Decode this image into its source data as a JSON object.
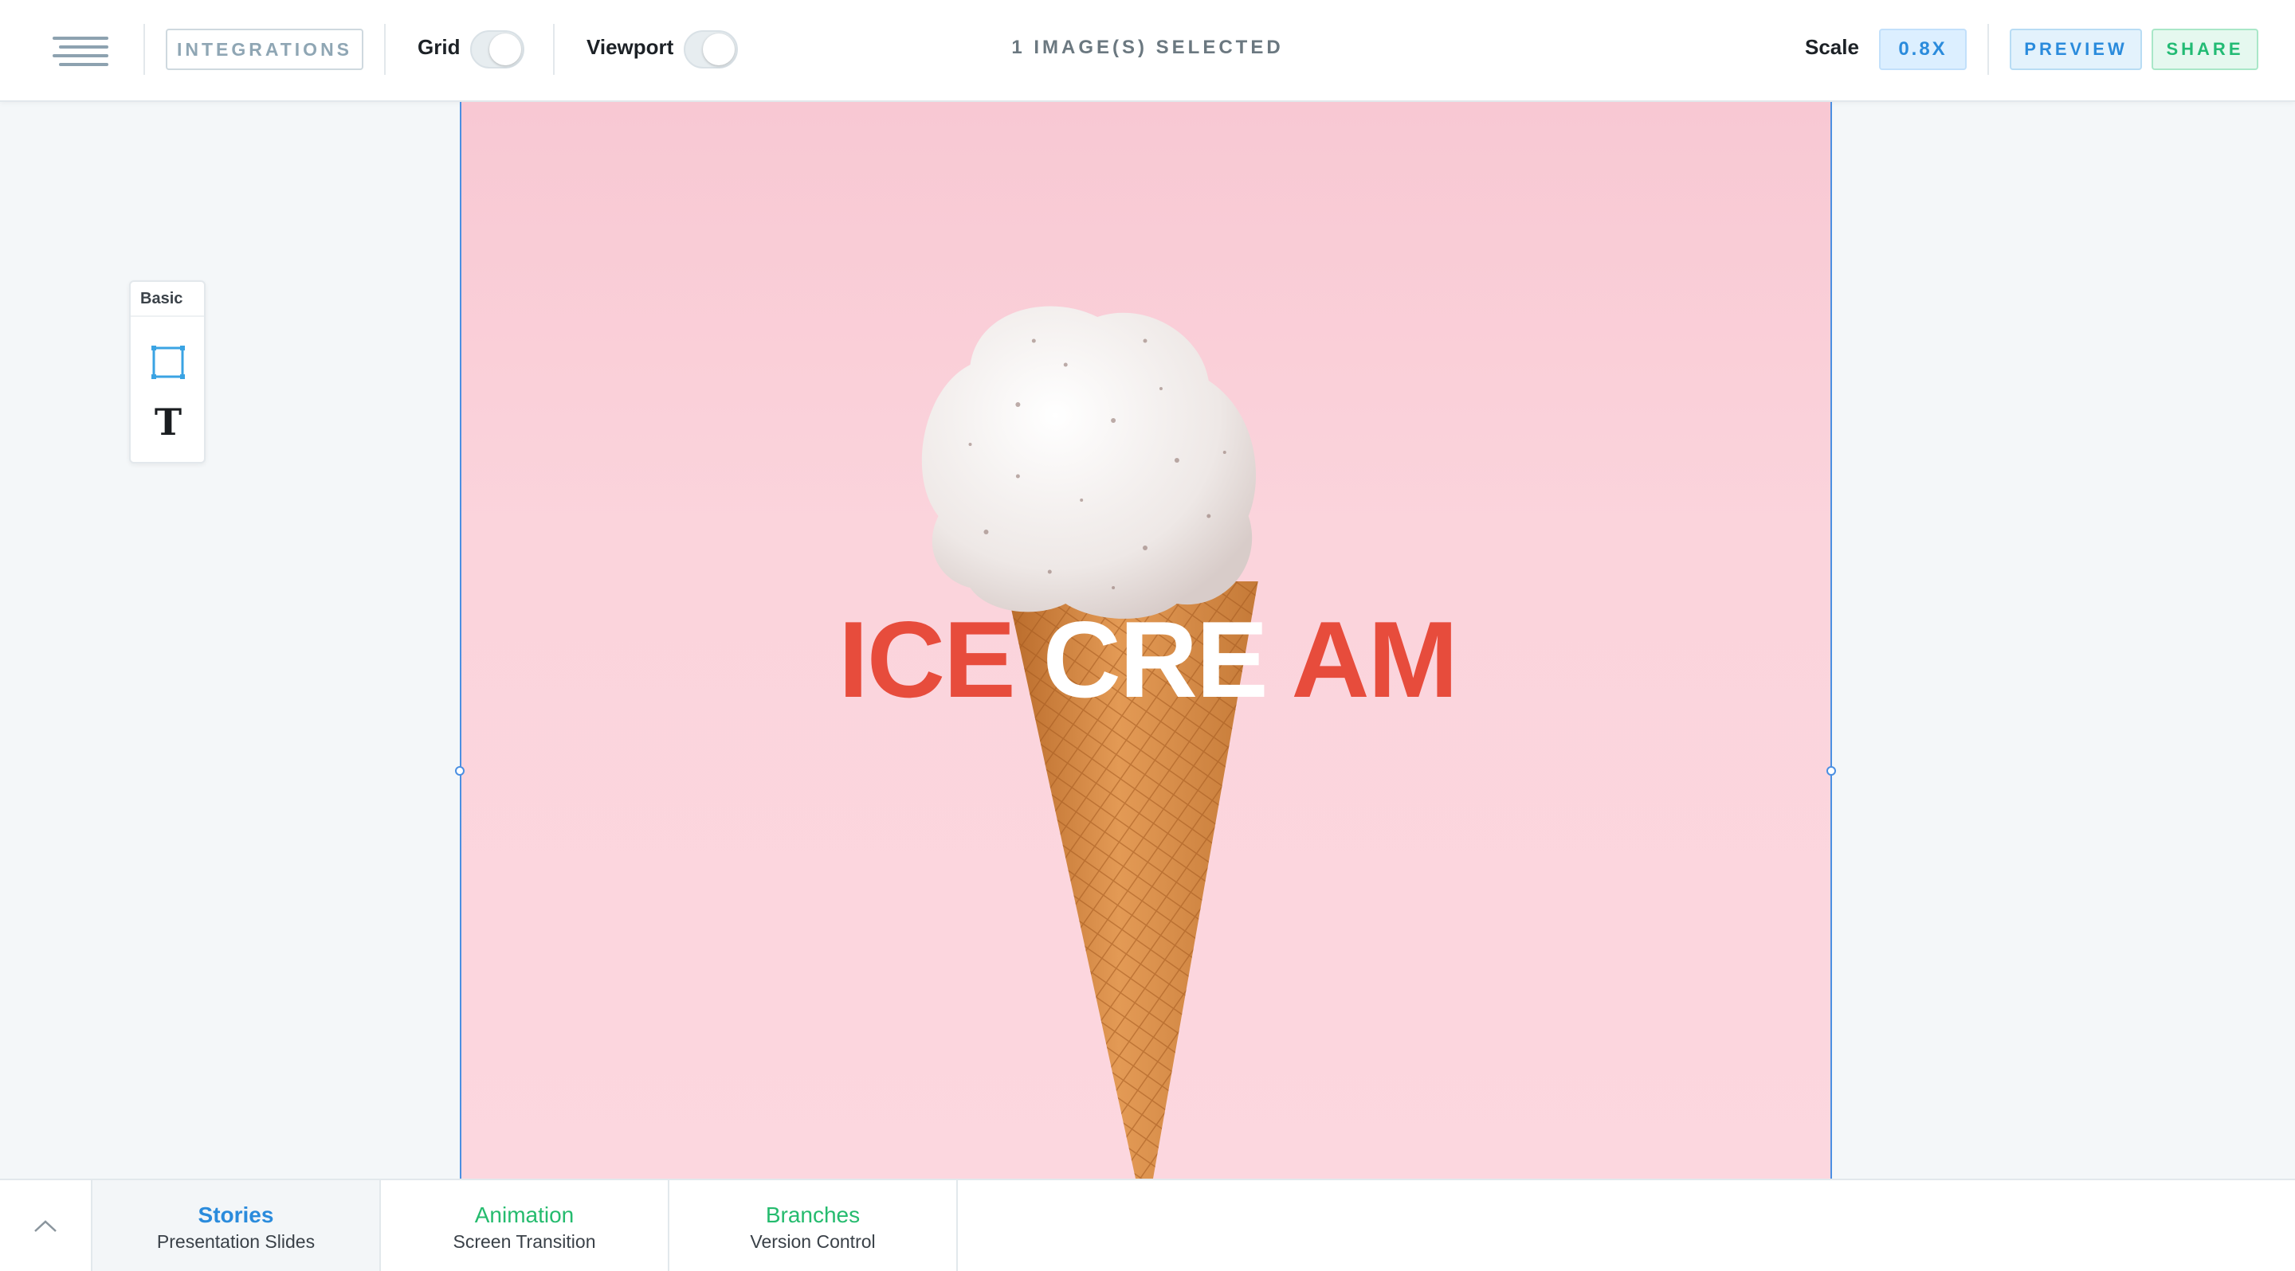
{
  "toolbar": {
    "integrations_label": "INTEGRATIONS",
    "grid_label": "Grid",
    "viewport_label": "Viewport",
    "status_text": "1 IMAGE(S) SELECTED",
    "scale_label": "Scale",
    "scale_value": "0.8X",
    "preview_label": "PREVIEW",
    "share_label": "SHARE",
    "grid_enabled": false,
    "viewport_enabled": false
  },
  "palette": {
    "title": "Basic",
    "tools": [
      {
        "icon": "rectangle-tool-icon"
      },
      {
        "icon": "text-tool-icon",
        "glyph": "T"
      }
    ]
  },
  "canvas": {
    "headline_part1": "ICE",
    "headline_part2": "CRE",
    "headline_part3": "AM",
    "background_color": "#fbd4dc",
    "text_red": "#e74c3c",
    "text_white": "#ffffff"
  },
  "bottom_tabs": [
    {
      "title": "Stories",
      "subtitle": "Presentation Slides",
      "active": true
    },
    {
      "title": "Animation",
      "subtitle": "Screen Transition",
      "active": false
    },
    {
      "title": "Branches",
      "subtitle": "Version Control",
      "active": false
    }
  ],
  "colors": {
    "accent_blue": "#2a8bdc",
    "accent_green": "#25bb6e",
    "selection_blue": "#4a8fe2"
  }
}
